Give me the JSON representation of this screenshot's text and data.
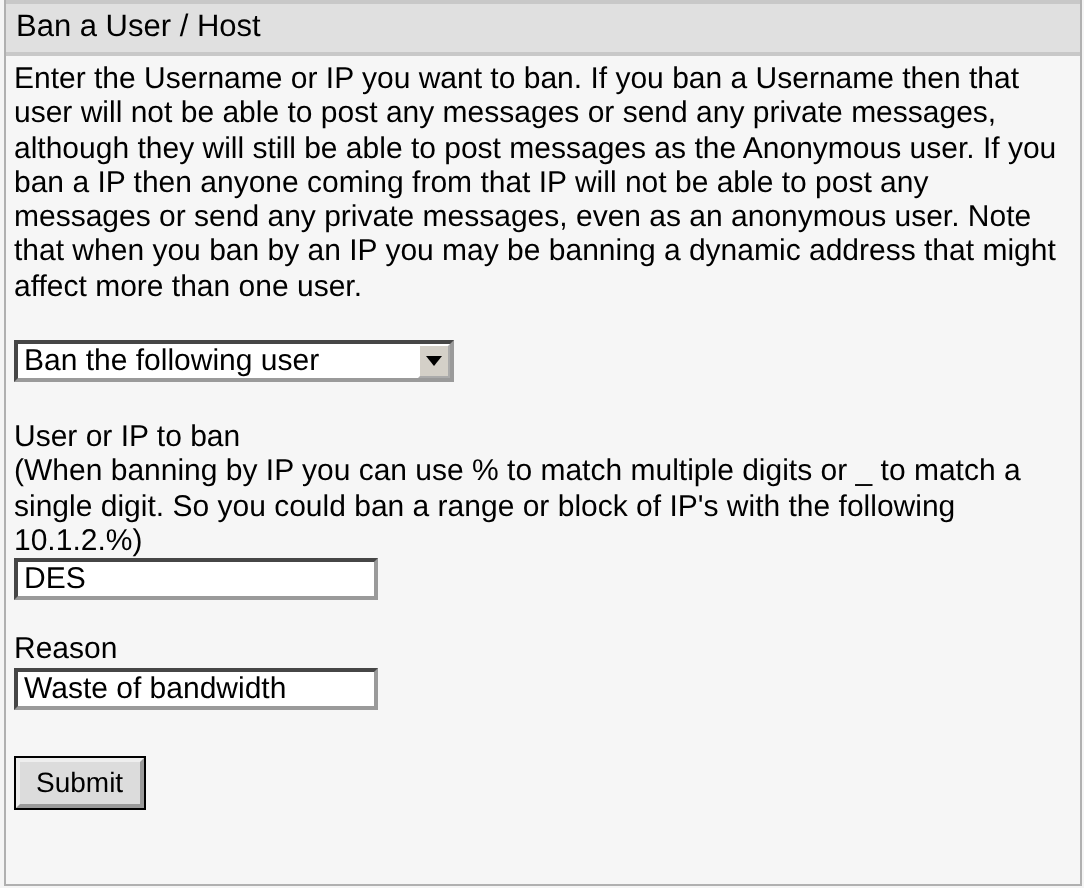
{
  "panel": {
    "title": "Ban a User / Host",
    "description": "Enter the Username or IP you want to ban. If you ban a Username then that user will not be able to post any messages or send any private messages, although they will still be able to post messages as the Anonymous user. If you ban a IP then anyone coming from that IP will not be able to post any messages or send any private messages, even as an anonymous user. Note that when you ban by an IP you may be banning a dynamic address that might affect more than one user.",
    "ban_type": {
      "value": "Ban the following user"
    },
    "target": {
      "label": "User or IP to ban",
      "hint": "(When banning by IP you can use % to match multiple digits or _ to match a single digit. So you could ban a range or block of IP's with the following 10.1.2.%)",
      "value": "DES"
    },
    "reason": {
      "label": "Reason",
      "value": "Waste of bandwidth"
    },
    "submit": "Submit"
  }
}
